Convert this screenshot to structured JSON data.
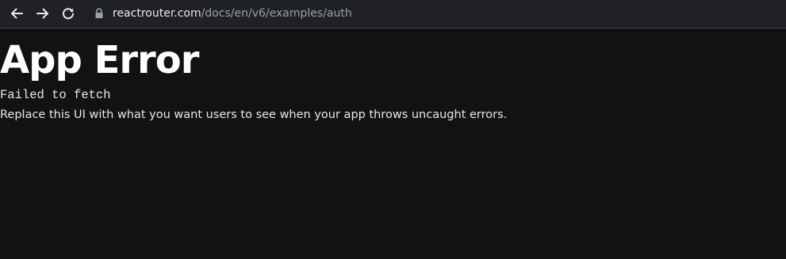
{
  "browser": {
    "url_host": "reactrouter.com",
    "url_path": "/docs/en/v6/examples/auth",
    "icons": {
      "back": "arrow-left",
      "forward": "arrow-right",
      "reload": "reload",
      "lock": "lock"
    }
  },
  "page": {
    "title": "App Error",
    "error_message": "Failed to fetch",
    "hint": "Replace this UI with what you want users to see when your app throws uncaught errors."
  },
  "colors": {
    "page_background": "#121212",
    "toolbar_background": "#202124",
    "text": "#ffffff",
    "url_path": "#9aa0a6"
  }
}
